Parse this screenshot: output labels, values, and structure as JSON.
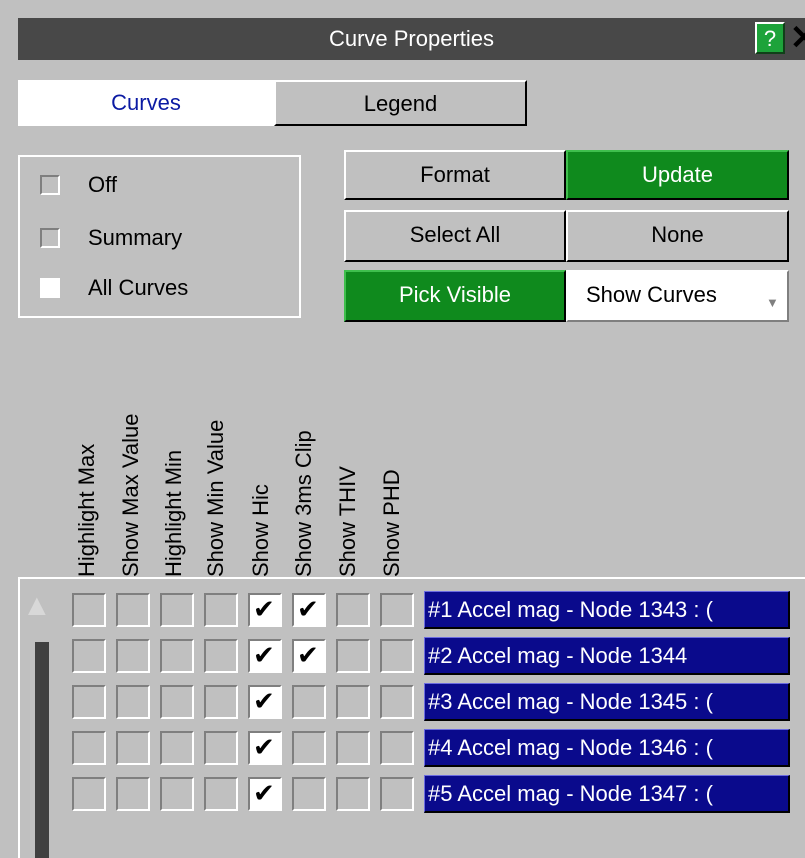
{
  "window": {
    "title": "Curve Properties",
    "help_label": "?",
    "close_label": "✕"
  },
  "tabs": [
    {
      "label": "Curves",
      "active": true
    },
    {
      "label": "Legend",
      "active": false
    }
  ],
  "mode_options": [
    {
      "label": "Off",
      "selected": false
    },
    {
      "label": "Summary",
      "selected": false
    },
    {
      "label": "All Curves",
      "selected": true
    }
  ],
  "buttons": {
    "format": "Format",
    "update": "Update",
    "select_all": "Select All",
    "none": "None",
    "pick_visible": "Pick Visible",
    "show_curves": "Show Curves"
  },
  "columns": [
    "Highlight Max",
    "Show Max Value",
    "Highlight Min",
    "Show Min Value",
    "Show Hic",
    "Show 3ms Clip",
    "Show THIV",
    "Show PHD"
  ],
  "rows": [
    {
      "label": "#1 Accel mag - Node 1343 : (",
      "checks": [
        false,
        false,
        false,
        false,
        true,
        true,
        false,
        false
      ]
    },
    {
      "label": "#2 Accel mag - Node 1344",
      "checks": [
        false,
        false,
        false,
        false,
        true,
        true,
        false,
        false
      ]
    },
    {
      "label": "#3 Accel mag - Node 1345 : (",
      "checks": [
        false,
        false,
        false,
        false,
        true,
        false,
        false,
        false
      ]
    },
    {
      "label": "#4 Accel mag - Node 1346 : (",
      "checks": [
        false,
        false,
        false,
        false,
        true,
        false,
        false,
        false
      ]
    },
    {
      "label": "#5 Accel mag - Node 1347 : (",
      "checks": [
        false,
        false,
        false,
        false,
        true,
        false,
        false,
        false
      ]
    }
  ],
  "colors": {
    "panel": "#c0c0c0",
    "title_bar": "#484848",
    "accent_green": "#0f8a1d",
    "row_label": "#0a0a8c",
    "tab_text": "#0b1aa3"
  },
  "icons": {
    "scroll_up": "▲",
    "dropdown": "▼"
  }
}
